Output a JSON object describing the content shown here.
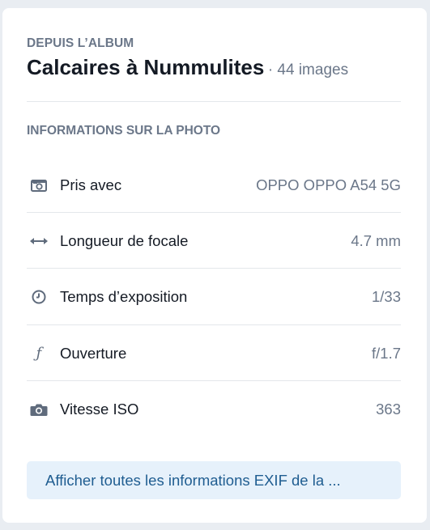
{
  "album": {
    "kicker": "DEPUIS L’ALBUM",
    "title": "Calcaires à Nummulites",
    "count": "· 44 images"
  },
  "photo_info": {
    "section_title": "INFORMATIONS SUR LA PHOTO",
    "rows": [
      {
        "icon": "camera-frame-icon",
        "label": "Pris avec",
        "value": "OPPO OPPO A54 5G"
      },
      {
        "icon": "double-arrow-icon",
        "label": "Longueur de focale",
        "value": "4.7 mm"
      },
      {
        "icon": "clock-icon",
        "label": "Temps d’exposition",
        "value": "1/33"
      },
      {
        "icon": "aperture-f-icon",
        "label": "Ouverture",
        "value": "f/1.7",
        "glyph": "ƒ"
      },
      {
        "icon": "camera-icon",
        "label": "Vitesse ISO",
        "value": "363"
      }
    ]
  },
  "exif_button": {
    "label": "Afficher toutes les informations EXIF de la ..."
  },
  "colors": {
    "muted": "#6b7789",
    "text": "#141a24",
    "button_bg": "#e6f1fb",
    "button_text": "#1f5d91"
  }
}
